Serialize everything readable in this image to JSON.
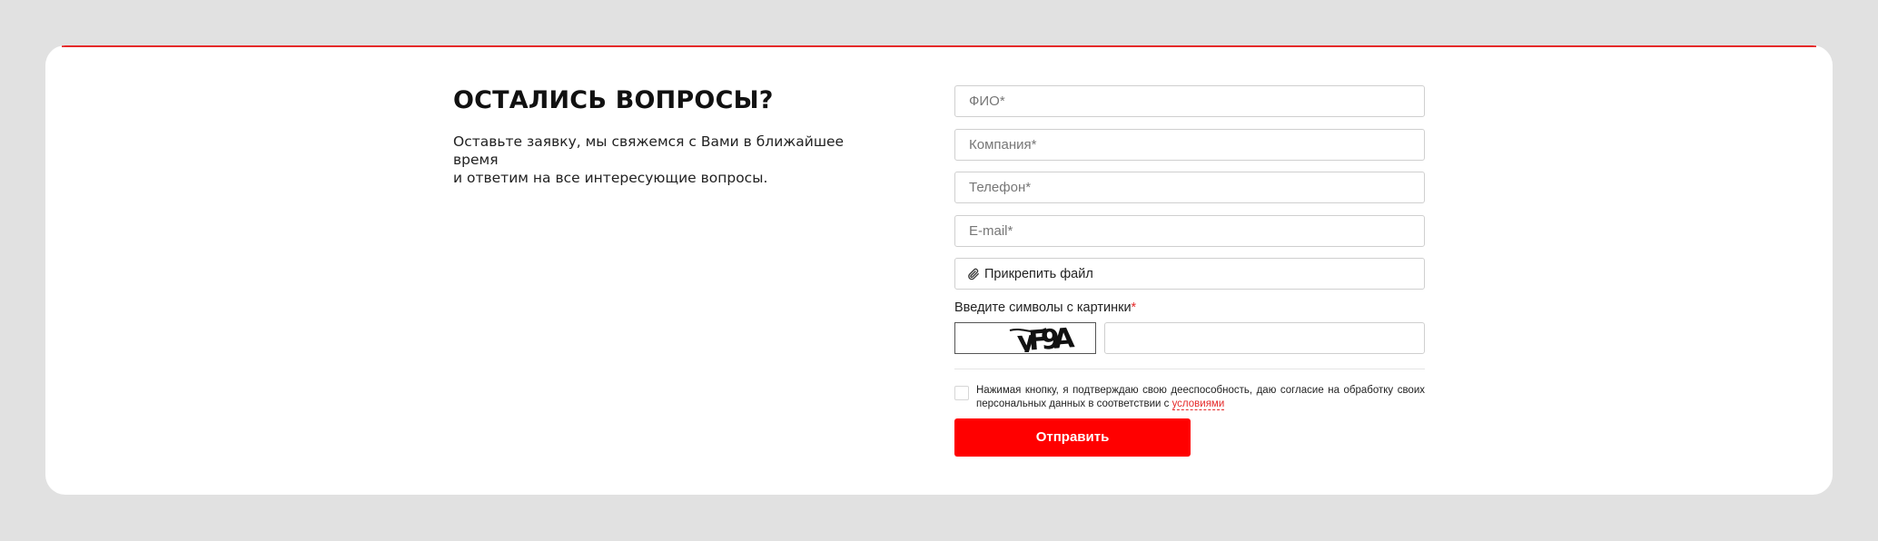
{
  "section": {
    "title": "ОСТАЛИСЬ ВОПРОСЫ?",
    "description": "Оставьте заявку, мы свяжемся с Вами в ближайшее время\nи ответим на все интересующие вопросы."
  },
  "form": {
    "fields": {
      "name_placeholder": "ФИО*",
      "company_placeholder": "Компания*",
      "phone_placeholder": "Телефон*",
      "email_placeholder": "E-mail*"
    },
    "attach_label": "Прикрепить файл",
    "attach_icon": "paperclip-icon",
    "captcha_label": "Введите символы с картинки",
    "captcha_required_mark": "*",
    "captcha_text": "yF9A",
    "consent_text": "Нажимая кнопку, я подтверждаю свою дееспособность, даю согласие на обработку своих персональных данных в соответствии с ",
    "consent_link": "условиями",
    "submit_label": "Отправить"
  },
  "colors": {
    "accent": "#e52a2a",
    "submit_bg": "#ff0000",
    "page_bg": "#e1e1e1",
    "card_bg": "#ffffff"
  }
}
